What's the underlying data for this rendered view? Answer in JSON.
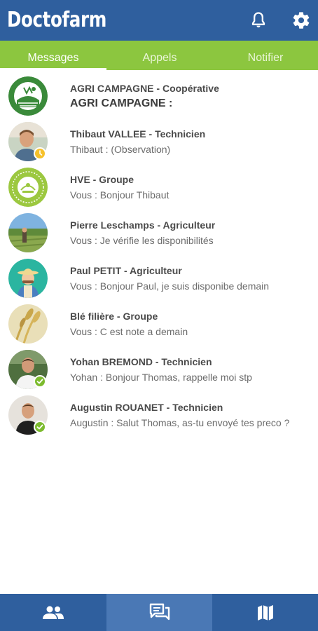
{
  "app": {
    "title": "Doctofarm"
  },
  "header": {
    "icons": [
      "bell-icon",
      "gear-icon"
    ]
  },
  "tabs": [
    {
      "label": "Messages",
      "active": true
    },
    {
      "label": "Appels",
      "active": false
    },
    {
      "label": "Notifier",
      "active": false
    }
  ],
  "conversations": [
    {
      "name": "AGRI CAMPAGNE  - Coopérative",
      "preview": "AGRI CAMPAGNE :",
      "avatar": "agri-campagne-logo",
      "status": ""
    },
    {
      "name": "Thibaut VALLEE - Technicien",
      "preview": "Thibaut : (Observation)",
      "avatar": "person-photo",
      "status": "pending"
    },
    {
      "name": "HVE - Groupe",
      "preview": "Vous :   Bonjour Thibaut",
      "avatar": "hve-logo",
      "status": ""
    },
    {
      "name": "Pierre Leschamps - Agriculteur",
      "preview": "Vous : Je vérifie les disponibilités",
      "avatar": "field-photo",
      "status": ""
    },
    {
      "name": "Paul PETIT - Agriculteur",
      "preview": "Vous : Bonjour Paul, je suis disponibe demain",
      "avatar": "farmer-illustration",
      "status": ""
    },
    {
      "name": "Blé filière  - Groupe",
      "preview": "Vous :   C est note a demain",
      "avatar": "wheat-photo",
      "status": ""
    },
    {
      "name": "Yohan BREMOND - Technicien",
      "preview": "Yohan : Bonjour Thomas, rappelle moi stp",
      "avatar": "person-photo",
      "status": "ok"
    },
    {
      "name": "Augustin ROUANET - Technicien",
      "preview": "Augustin : Salut Thomas, as-tu envoyé tes preco ?",
      "avatar": "person-photo",
      "status": "ok"
    }
  ],
  "bottom_nav": [
    {
      "icon": "contacts-icon",
      "active": false
    },
    {
      "icon": "chat-icon",
      "active": true
    },
    {
      "icon": "map-icon",
      "active": false
    }
  ],
  "colors": {
    "header": "#2f5f9e",
    "tabs": "#8cc63f",
    "nav_active": "#4a78b5",
    "badge_pending": "#f6c12b",
    "badge_ok": "#7cbb2e"
  }
}
